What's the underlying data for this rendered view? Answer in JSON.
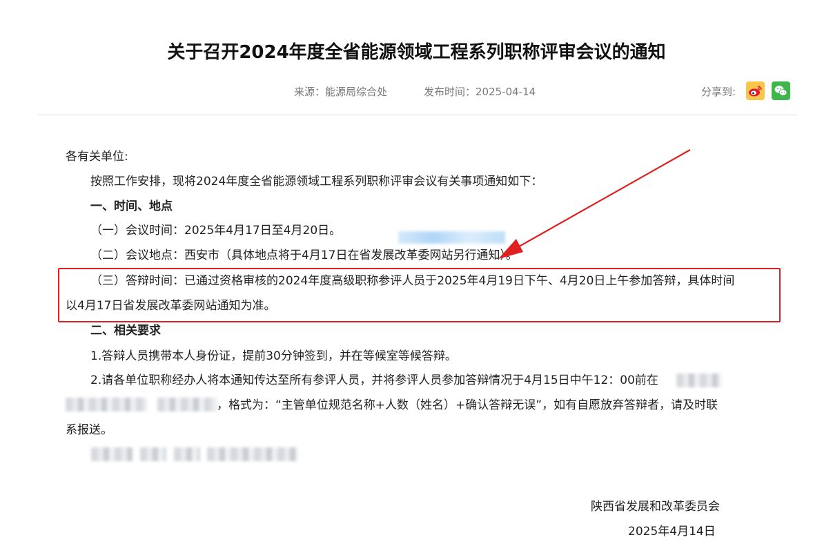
{
  "article": {
    "title": "关于召开2024年度全省能源领域工程系列职称评审会议的通知",
    "source": "来源：能源局综合处",
    "publish_time": "发布时间：2025-04-14",
    "share_label": "分享到:"
  },
  "share_icons": [
    "weibo-icon",
    "wechat-icon"
  ],
  "body": {
    "salutation": "各有关单位:",
    "intro": "按照工作安排，现将2024年度全省能源领域工程系列职称评审会议有关事项通知如下：",
    "section1_heading": "一、时间、地点",
    "item1": "（一）会议时间：2025年4月17日至4月20日。",
    "item2": "（二）会议地点：西安市（具体地点将于4月17日在省发展改革委网站另行通知）。",
    "item3_line1": "（三）答辩时间：已通过资格审核的2024年度高级职称参评人员于2025年4月19日下午、4月20日上午参加答辩，具体时间",
    "item3_line2": "以4月17日省发展改革委网站通知为准。",
    "section2_heading": "二、相关要求",
    "req1": "1.答辩人员携带本人身份证，提前30分钟签到，并在等候室等候答辩。",
    "req2_line1": "2.请各单位职称经办人将本通知传达至所有参评人员，并将参评人员参加答辩情况于4月15日中午12：00前在",
    "req2_line2": "，格式为：“主管单位规范名称+人数（姓名）+确认答辩无误”，如有自愿放弃答辩者，请及时联",
    "req2_line3": "系报送。"
  },
  "signature": {
    "org": "陕西省发展和改革委员会",
    "date": "2025年4月14日"
  },
  "colors": {
    "highlight_border": "#e02020",
    "arrow": "#e02020",
    "weibo_bg": "#f7c64a",
    "wechat_bg": "#3fb64a",
    "meta_text": "#777777"
  }
}
